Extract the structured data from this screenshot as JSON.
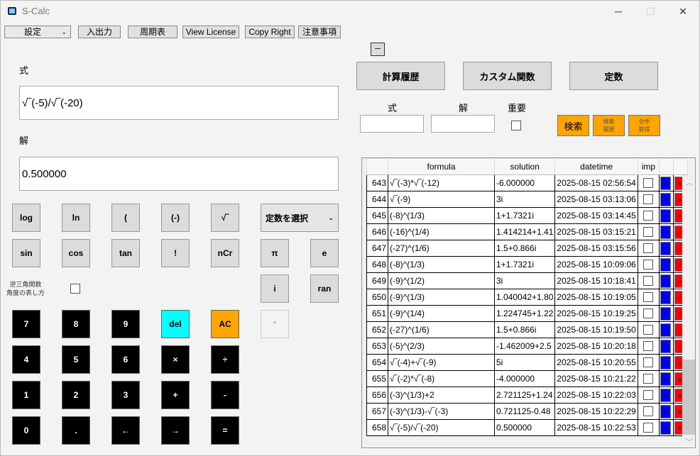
{
  "window": {
    "title": "S-Calc",
    "minimize": "─",
    "maximize": "☐",
    "close": "✕"
  },
  "menu": {
    "settings": "設定",
    "io": "入出力",
    "periodic": "周期表",
    "license": "View License",
    "copyright": "Copy Right",
    "notes": "注意事項"
  },
  "left": {
    "formula_label": "式",
    "formula_value": "√‾(-5)/√‾(-20)",
    "solution_label": "解",
    "solution_value": "0.500000",
    "inverse_label_1": "逆三角関数",
    "inverse_label_2": "角度の表し方",
    "constant_select": "定数を選択"
  },
  "keys": {
    "gray": [
      [
        "log",
        "ln",
        "(",
        "(-)",
        "√‾"
      ],
      [
        "sin",
        "cos",
        "tan",
        "!",
        "nCr"
      ]
    ],
    "black": [
      [
        "7",
        "8",
        "9",
        "del",
        "AC"
      ],
      [
        "4",
        "5",
        "6",
        "×",
        "÷"
      ],
      [
        "1",
        "2",
        "3",
        "+",
        "-"
      ],
      [
        "0",
        ".",
        "←",
        "→",
        "="
      ]
    ],
    "side": [
      "π",
      "e",
      "i",
      "ran",
      "°"
    ]
  },
  "right": {
    "collapse": "─",
    "tabs": [
      "計算履歴",
      "カスタム関数",
      "定数"
    ],
    "search_formula_label": "式",
    "search_solution_label": "解",
    "important_label": "重要",
    "search_button": "検索",
    "search_history_1": "検索",
    "search_history_2": "履歴",
    "get_all_1": "全件",
    "get_all_2": "取得"
  },
  "table": {
    "headers": [
      "",
      "formula",
      "solution",
      "datetime",
      "imp",
      "",
      ""
    ],
    "rows": [
      [
        "643",
        "√‾(-3)*√‾(-12)",
        "-6.000000",
        "2025-08-15 02:56:54"
      ],
      [
        "644",
        "√‾(-9)",
        "3i",
        "2025-08-15 03:13:06"
      ],
      [
        "645",
        "(-8)^(1/3)",
        "1+1.7321i",
        "2025-08-15 03:14:45"
      ],
      [
        "646",
        "(-16)^(1/4)",
        "1.414214+1.41",
        "2025-08-15 03:15:21"
      ],
      [
        "647",
        "(-27)^(1/6)",
        "1.5+0.866i",
        "2025-08-15 03:15:56"
      ],
      [
        "648",
        "(-8)^(1/3)",
        "1+1.7321i",
        "2025-08-15 10:09:06"
      ],
      [
        "649",
        "(-9)^(1/2)",
        "3i",
        "2025-08-15 10:18:41"
      ],
      [
        "650",
        "(-9)^(1/3)",
        "1.040042+1.80",
        "2025-08-15 10:19:05"
      ],
      [
        "651",
        "(-9)^(1/4)",
        "1.224745+1.22",
        "2025-08-15 10:19:25"
      ],
      [
        "652",
        "(-27)^(1/6)",
        "1.5+0.866i",
        "2025-08-15 10:19:50"
      ],
      [
        "653",
        "(-5)^(2/3)",
        "-1.462009+2.5",
        "2025-08-15 10:20:18"
      ],
      [
        "654",
        "√‾(-4)+√‾(-9)",
        "5i",
        "2025-08-15 10:20:55"
      ],
      [
        "655",
        "√‾(-2)*√‾(-8)",
        "-4.000000",
        "2025-08-15 10:21:22"
      ],
      [
        "656",
        "(-3)^(1/3)+2",
        "2.721125+1.24",
        "2025-08-15 10:22:03"
      ],
      [
        "657",
        "(-3)^(1/3)-√‾(-3)",
        "0.721125-0.48",
        "2025-08-15 10:22:29"
      ],
      [
        "658",
        "√‾(-5)/√‾(-20)",
        "0.500000",
        "2025-08-15 10:22:53"
      ]
    ],
    "check_glyph": "✓",
    "delete_glyph": "×"
  },
  "colors": {
    "del": "#00ffff",
    "ac": "#ffa500",
    "blue": "#0000ff",
    "red": "#ff0000"
  }
}
